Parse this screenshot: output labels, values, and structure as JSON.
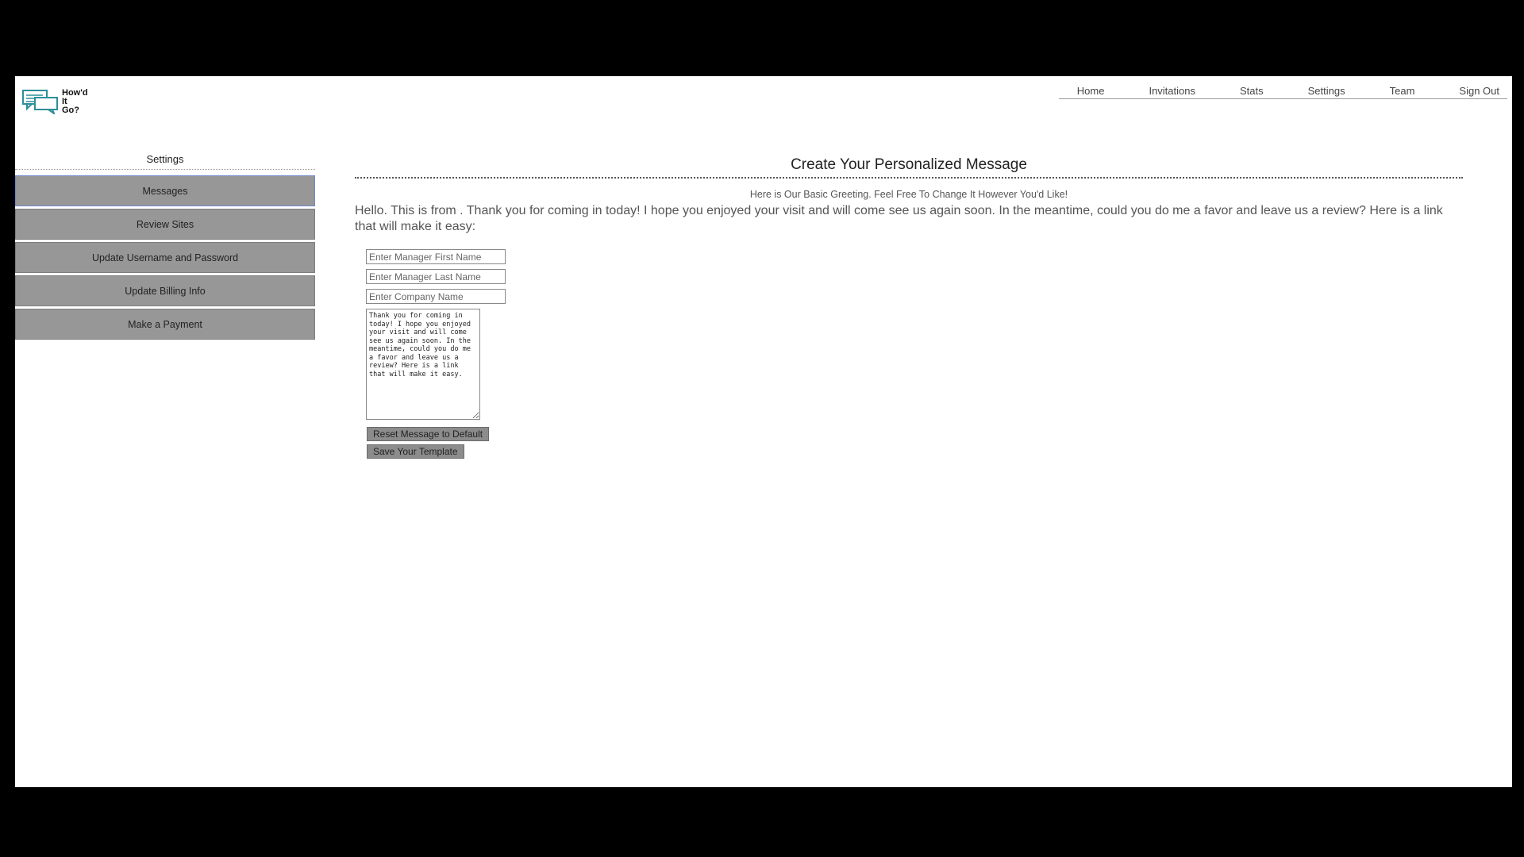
{
  "logo": {
    "text": "How'd\nIt\nGo?"
  },
  "nav": {
    "items": [
      "Home",
      "Invitations",
      "Stats",
      "Settings",
      "Team",
      "Sign Out"
    ]
  },
  "sidebar": {
    "title": "Settings",
    "items": [
      {
        "label": "Messages",
        "active": true
      },
      {
        "label": "Review Sites"
      },
      {
        "label": "Update Username and Password"
      },
      {
        "label": "Update Billing Info"
      },
      {
        "label": "Make a Payment"
      }
    ]
  },
  "main": {
    "title": "Create Your Personalized Message",
    "subtitle": "Here is Our Basic Greeting. Feel Free To Change It However You'd Like!",
    "greeting": "Hello. This is from . Thank you for coming in today! I hope you enjoyed your visit and will come see us again soon. In the meantime, could you do me a favor and leave us a review? Here is a link that will make it easy:",
    "fields": {
      "first_name_placeholder": "Enter Manager First Name",
      "last_name_placeholder": "Enter Manager Last Name",
      "company_placeholder": "Enter Company Name"
    },
    "message_text": "Thank you for coming in today! I hope you enjoyed your visit and will come see us again soon. In the meantime, could you do me a favor and leave us a review? Here is a link that will make it easy.",
    "reset_label": "Reset Message to Default",
    "save_label": "Save Your Template"
  },
  "colors": {
    "button_bg": "#8c8c8c",
    "sidebar_bg": "#979797",
    "active_border": "#6f88c7"
  }
}
